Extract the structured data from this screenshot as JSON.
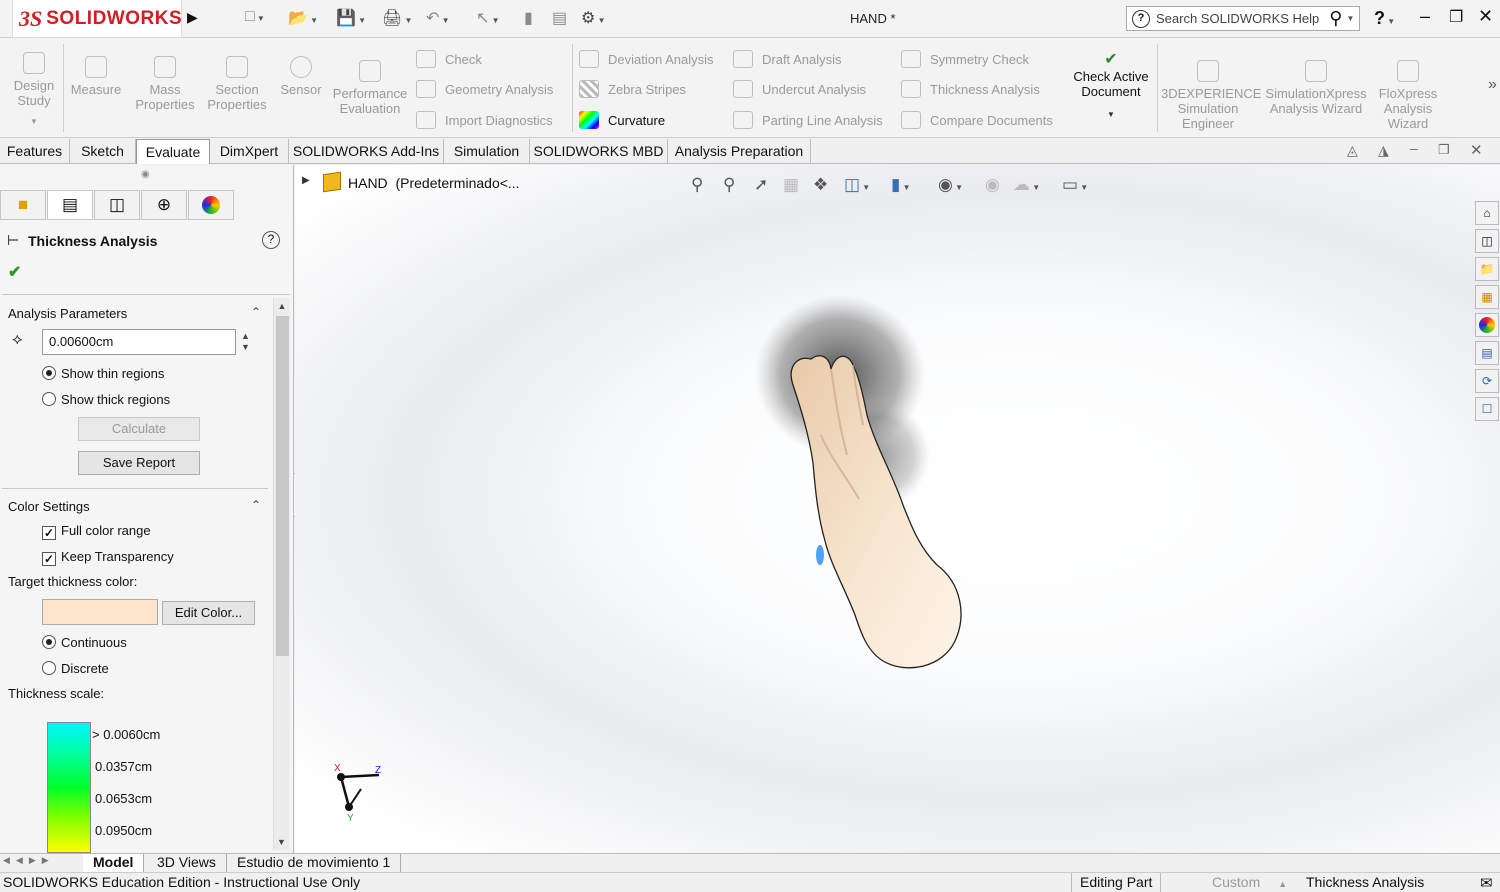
{
  "app": {
    "logo_ds": "3S",
    "logo_text": "SOLIDWORKS",
    "document_title": "HAND *"
  },
  "search": {
    "placeholder": "Search SOLIDWORKS Help"
  },
  "command_manager": {
    "big_tools": [
      {
        "label": "Design Study",
        "icon": "design-study-icon"
      },
      {
        "label": "Measure",
        "icon": "measure-icon"
      },
      {
        "label": "Mass Properties",
        "icon": "mass-properties-icon"
      },
      {
        "label": "Section Properties",
        "icon": "section-properties-icon"
      },
      {
        "label": "Sensor",
        "icon": "sensor-icon"
      },
      {
        "label": "Performance Evaluation",
        "icon": "performance-icon"
      }
    ],
    "col1": [
      "Check",
      "Geometry Analysis",
      "Import Diagnostics"
    ],
    "col2": [
      "Deviation Analysis",
      "Zebra Stripes",
      "Curvature"
    ],
    "col3": [
      "Draft Analysis",
      "Undercut Analysis",
      "Parting Line Analysis"
    ],
    "col4": [
      "Symmetry Check",
      "Thickness Analysis",
      "Compare Documents"
    ],
    "check_active": "Check Active Document",
    "right_tools": [
      "3DEXPERIENCE Simulation Engineer",
      "SimulationXpress Analysis Wizard",
      "FloXpress Analysis Wizard"
    ]
  },
  "tabs": [
    "Features",
    "Sketch",
    "Evaluate",
    "DimXpert",
    "SOLIDWORKS Add-Ins",
    "Simulation",
    "SOLIDWORKS MBD",
    "Analysis Preparation"
  ],
  "active_tab": "Evaluate",
  "panel": {
    "title": "Thickness Analysis",
    "analysis_parameters": "Analysis Parameters",
    "thickness_value": "0.00600cm",
    "show_thin": "Show thin regions",
    "show_thick": "Show thick regions",
    "calculate": "Calculate",
    "save_report": "Save Report",
    "color_settings": "Color Settings",
    "full_color_range": "Full color range",
    "keep_transparency": "Keep Transparency",
    "target_thickness_color": "Target thickness color:",
    "target_color": "#fde3cb",
    "edit_color": "Edit Color...",
    "continuous": "Continuous",
    "discrete": "Discrete",
    "thickness_scale": "Thickness scale:",
    "scale_values": [
      "> 0.0060cm",
      "0.0357cm",
      "0.0653cm",
      "0.0950cm"
    ]
  },
  "tree": {
    "root": "HAND",
    "config": "(Predeterminado<..."
  },
  "bottom_tabs": [
    "Model",
    "3D Views",
    "Estudio de movimiento 1"
  ],
  "status": {
    "edition": "SOLIDWORKS Education Edition - Instructional Use Only",
    "editing": "Editing Part",
    "units": "Custom",
    "command": "Thickness Analysis"
  },
  "triad": {
    "x": "X",
    "y": "Y",
    "z": "Z"
  }
}
